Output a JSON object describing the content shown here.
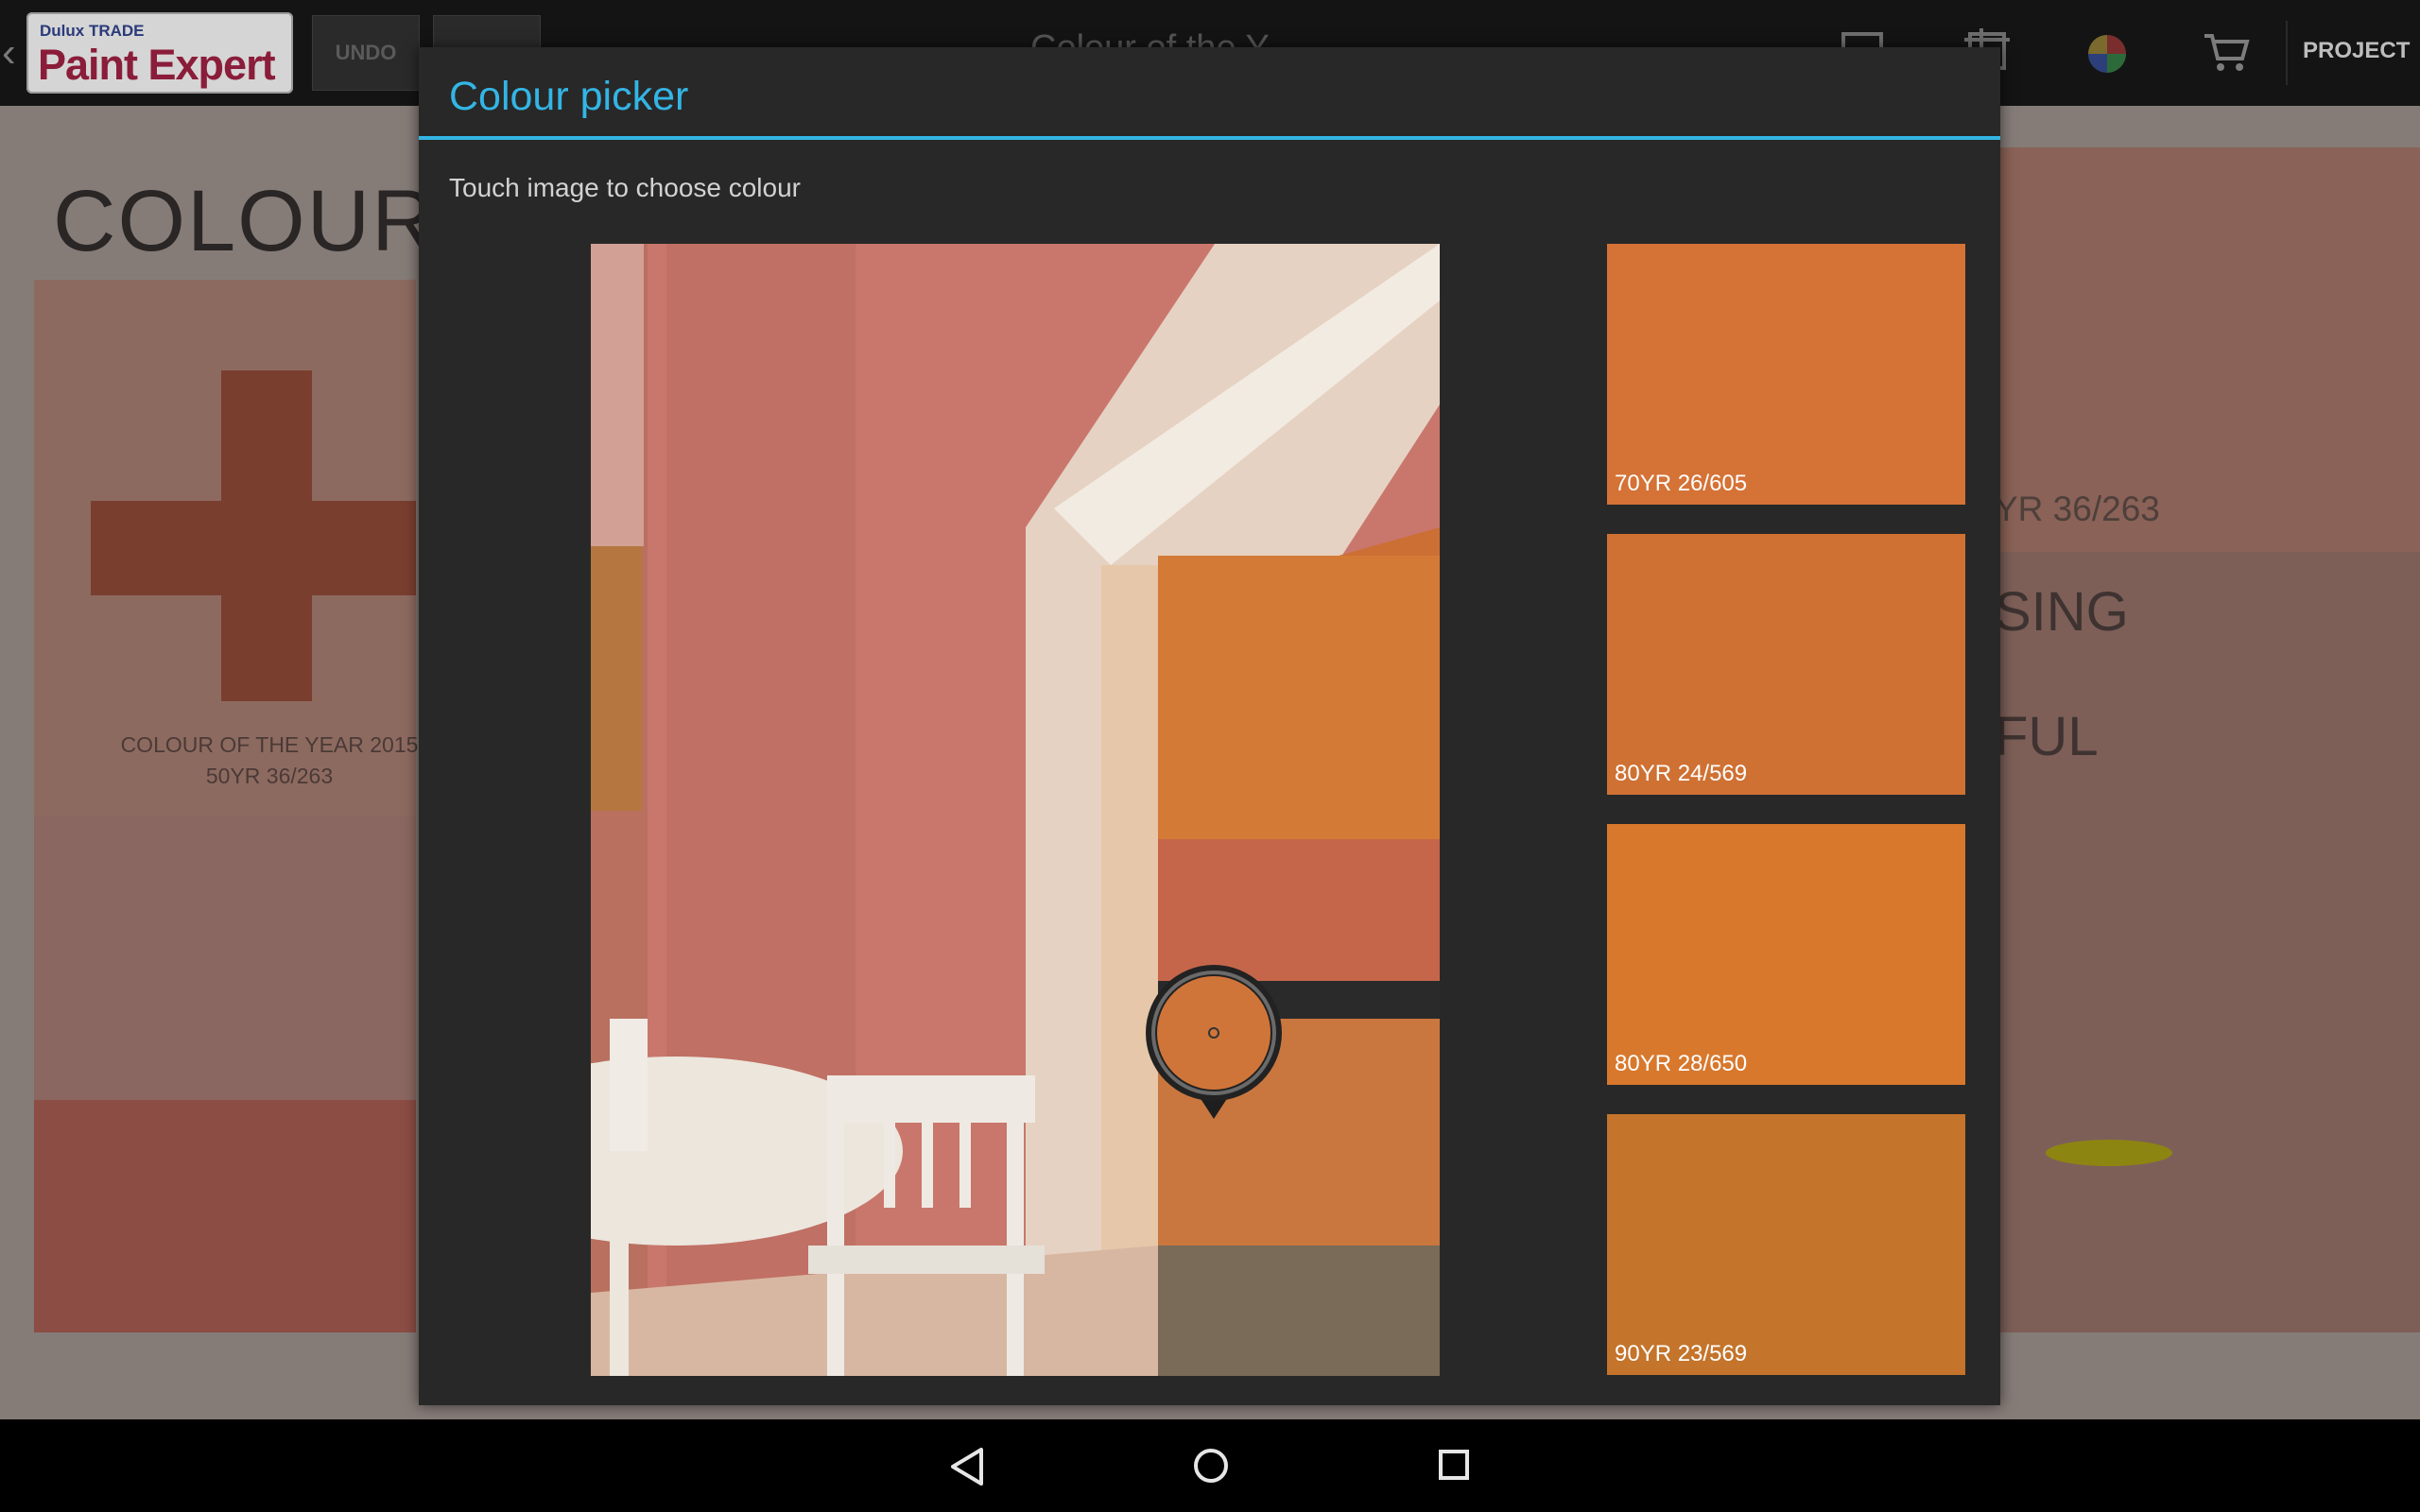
{
  "app": {
    "logo_top": "Dulux TRADE",
    "logo_main": "Paint Expert",
    "undo_label": "UNDO",
    "bar_title": "Colour of the Y",
    "project_label": "PROJECT"
  },
  "background": {
    "heading": "COLOUR O",
    "left_caption_line1": "COLOUR OF THE YEAR 2015",
    "left_caption_line2": "50YR 36/263",
    "right_code": "YR 36/263",
    "right_word1": "SING",
    "right_word2": "FUL"
  },
  "dialog": {
    "title": "Colour picker",
    "subtitle": "Touch image to choose colour",
    "swatches": [
      {
        "label": "70YR 26/605",
        "color": "#d57236"
      },
      {
        "label": "80YR 24/569",
        "color": "#cf7133"
      },
      {
        "label": "80YR 28/650",
        "color": "#d8782d"
      },
      {
        "label": "90YR 23/569",
        "color": "#c4742b"
      }
    ],
    "picker_color": "#d07539"
  },
  "colors": {
    "accent": "#33b5e5"
  }
}
